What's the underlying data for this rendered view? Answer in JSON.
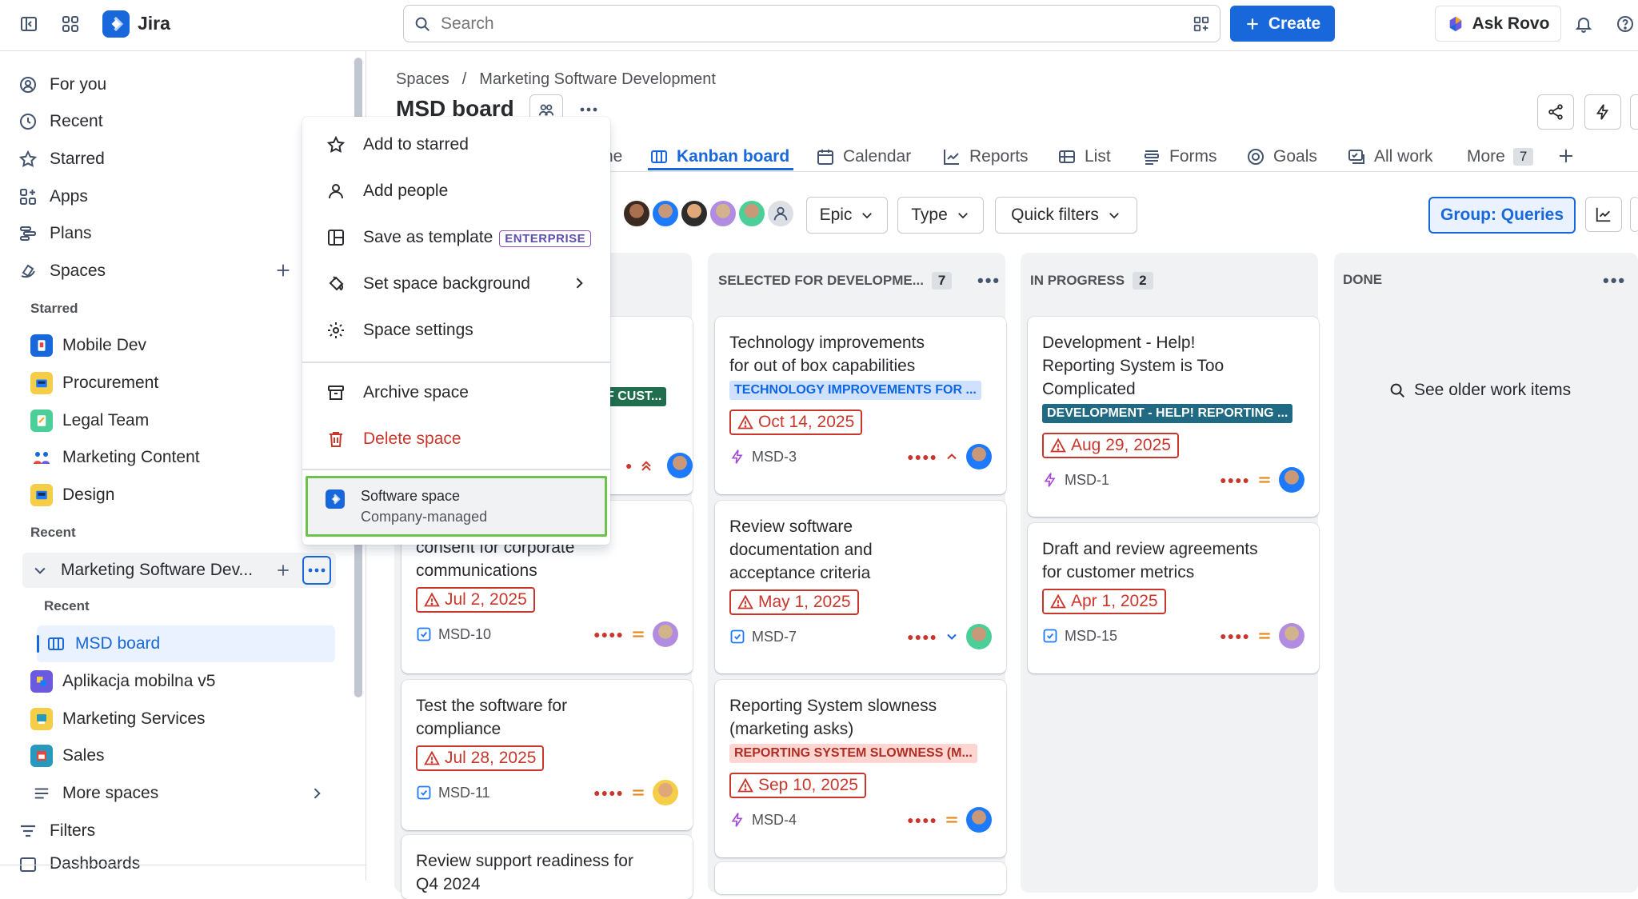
{
  "topbar": {
    "app_name": "Jira",
    "search_placeholder": "Search",
    "create_label": "Create",
    "rovo_label": "Ask Rovo"
  },
  "sidebar": {
    "nav": [
      "For you",
      "Recent",
      "Starred",
      "Apps",
      "Plans",
      "Spaces"
    ],
    "starred_heading": "Starred",
    "starred": [
      "Mobile Dev",
      "Procurement",
      "Legal Team",
      "Marketing Content",
      "Design"
    ],
    "recent_heading": "Recent",
    "current_project": "Marketing Software Dev...",
    "project_recent_heading": "Recent",
    "board_item": "MSD board",
    "recent": [
      "Aplikacja mobilna v5",
      "Marketing Services",
      "Sales"
    ],
    "more_spaces": "More spaces",
    "filters": "Filters",
    "dashboards": "Dashboards"
  },
  "main": {
    "breadcrumb": [
      "Spaces",
      "/",
      "Marketing Software Development"
    ],
    "title": "MSD board",
    "tabs": [
      "ne",
      "Kanban board",
      "Calendar",
      "Reports",
      "List",
      "Forms",
      "Goals",
      "All work",
      "More"
    ],
    "more_count": "7",
    "filters": [
      "Epic",
      "Type",
      "Quick filters"
    ],
    "group_label": "Group: Queries"
  },
  "columns": [
    {
      "title": "SELECTED FOR DEVELOPME...",
      "count": "7"
    },
    {
      "title": "IN PROGRESS",
      "count": "2"
    },
    {
      "title": "DONE",
      "count": ""
    }
  ],
  "done_link": "See older work items",
  "cards": {
    "c0_tag": "F CUST...",
    "c1": {
      "title_line1": "consent for corporate",
      "title_line2": "communications",
      "due": "Jul 2, 2025",
      "key": "MSD-10"
    },
    "c2": {
      "title_line1": "Test the software for",
      "title_line2": "compliance",
      "due": "Jul 28, 2025",
      "key": "MSD-11"
    },
    "c3": {
      "title_line1": "Review support readiness for",
      "title_line2": "Q4 2024"
    },
    "s1": {
      "title_line1": "Technology improvements",
      "title_line2": "for out of box capabilities",
      "tag": "TECHNOLOGY IMPROVEMENTS FOR ...",
      "due": "Oct 14, 2025",
      "key": "MSD-3"
    },
    "s2": {
      "title_line1": "Review software",
      "title_line2": "documentation and",
      "title_line3": "acceptance criteria",
      "due": "May 1, 2025",
      "key": "MSD-7"
    },
    "s3": {
      "title_line1": "Reporting System slowness",
      "title_line2": "(marketing asks)",
      "tag": "REPORTING SYSTEM SLOWNESS (M...",
      "due": "Sep 10, 2025",
      "key": "MSD-4"
    },
    "p1": {
      "title_line1": "Development - Help!",
      "title_line2": "Reporting System is Too",
      "title_line3": "Complicated",
      "tag": "DEVELOPMENT - HELP! REPORTING ...",
      "due": "Aug 29, 2025",
      "key": "MSD-1"
    },
    "p2": {
      "title_line1": "Draft and review agreements",
      "title_line2": "for customer metrics",
      "due": "Apr 1, 2025",
      "key": "MSD-15"
    }
  },
  "menu": {
    "items": [
      "Add to starred",
      "Add people",
      "Save as template",
      "Set space background",
      "Space settings",
      "Archive space",
      "Delete space"
    ],
    "enterprise_badge": "ENTERPRISE",
    "space_type": "Software space",
    "space_sub": "Company-managed"
  },
  "colors": {
    "accent": "#1868db",
    "danger": "#c9372c",
    "highlight": "#6cc24a"
  }
}
